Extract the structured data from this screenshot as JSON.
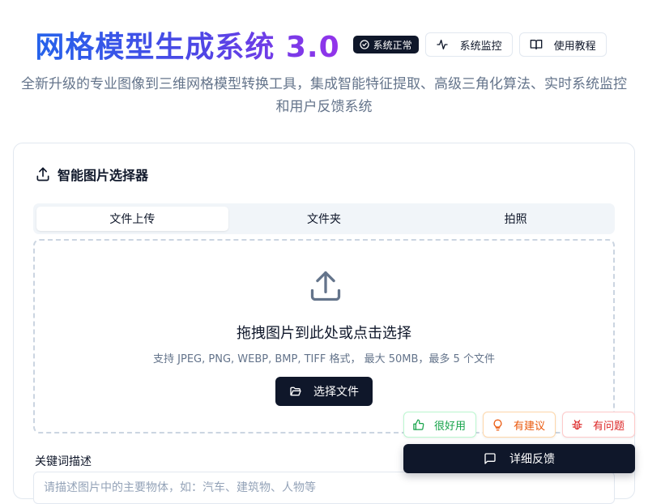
{
  "header": {
    "title": "网格模型生成系统 3.0",
    "status_badge": "系统正常",
    "monitor_label": "系统监控",
    "tutorial_label": "使用教程"
  },
  "subtitle": "全新升级的专业图像到三维网格模型转换工具，集成智能特征提取、高级三角化算法、实时系统监控和用户反馈系统",
  "selector": {
    "title": "智能图片选择器",
    "tabs": [
      {
        "label": "文件上传",
        "active": true
      },
      {
        "label": "文件夹",
        "active": false
      },
      {
        "label": "拍照",
        "active": false
      }
    ],
    "dropzone": {
      "title": "拖拽图片到此处或点击选择",
      "hint": "支持 JPEG, PNG, WEBP, BMP, TIFF 格式， 最大 50MB，最多 5 个文件",
      "button_label": "选择文件"
    },
    "keywords": {
      "label": "关键词描述",
      "placeholder": "请描述图片中的主要物体，如：汽车、建筑物、人物等"
    }
  },
  "feedback": {
    "good_label": "很好用",
    "idea_label": "有建议",
    "bug_label": "有问题",
    "detail_label": "详细反馈"
  },
  "colors": {
    "title_gradient_start": "#2563eb",
    "title_gradient_end": "#9333ea",
    "dark": "#0f172a",
    "good": "#16a34a",
    "idea": "#ea580c",
    "bug": "#dc2626"
  }
}
